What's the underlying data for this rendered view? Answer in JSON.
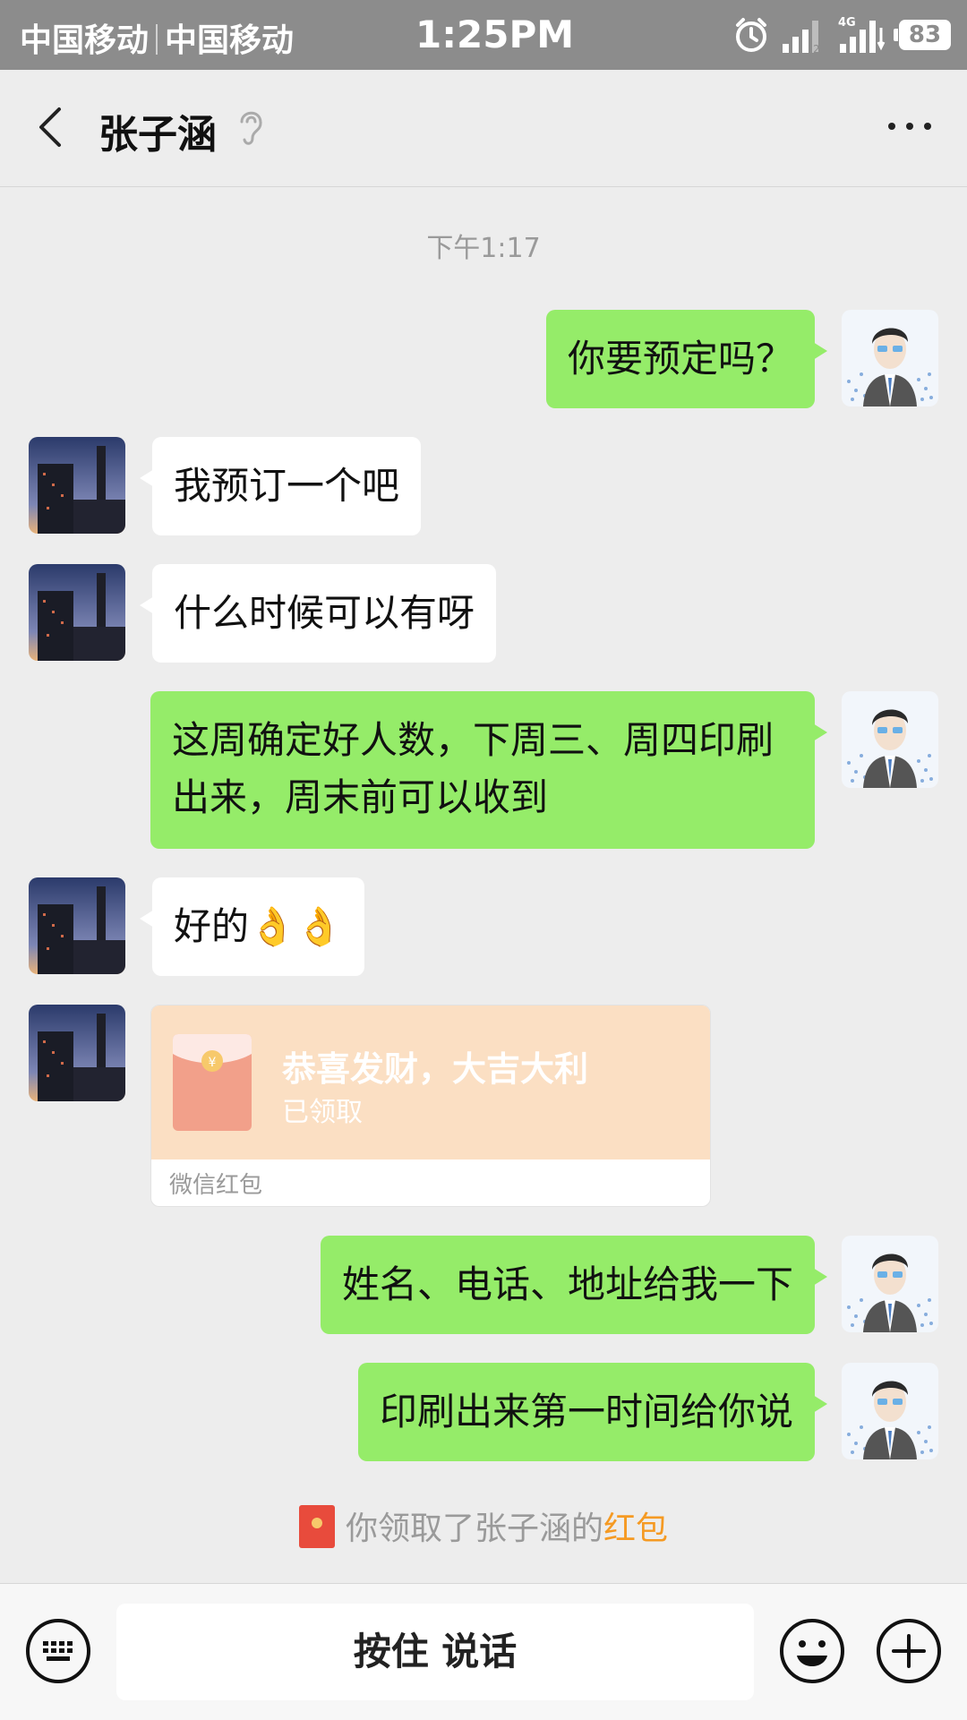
{
  "status_bar": {
    "carrier_1": "中国移动",
    "carrier_2": "中国移动",
    "time": "1:25PM",
    "network": "4G",
    "sim_slot": "2",
    "battery": "83"
  },
  "header": {
    "contact_name": "张子涵"
  },
  "chat": {
    "timestamp": "下午1:17",
    "messages": [
      {
        "sender": "me",
        "text": "你要预定吗？"
      },
      {
        "sender": "contact",
        "text": "我预订一个吧"
      },
      {
        "sender": "contact",
        "text": "什么时候可以有呀"
      },
      {
        "sender": "me",
        "text": "这周确定好人数，下周三、周四印刷出来，周末前可以收到"
      },
      {
        "sender": "contact",
        "text": "好的👌👌"
      },
      {
        "sender": "contact",
        "type": "red_packet",
        "title": "恭喜发财，大吉大利",
        "status": "已领取",
        "footer": "微信红包"
      },
      {
        "sender": "me",
        "text": "姓名、电话、地址给我一下"
      },
      {
        "sender": "me",
        "text": "印刷出来第一时间给你说"
      }
    ],
    "system_message": {
      "text": "你领取了张子涵的",
      "link": "红包"
    }
  },
  "input_bar": {
    "hold_to_talk": "按住 说话"
  },
  "colors": {
    "my_bubble": "#95ec69",
    "their_bubble": "#ffffff",
    "background": "#ededed",
    "red_packet": "#fbdfc3",
    "link": "#f59a23"
  }
}
